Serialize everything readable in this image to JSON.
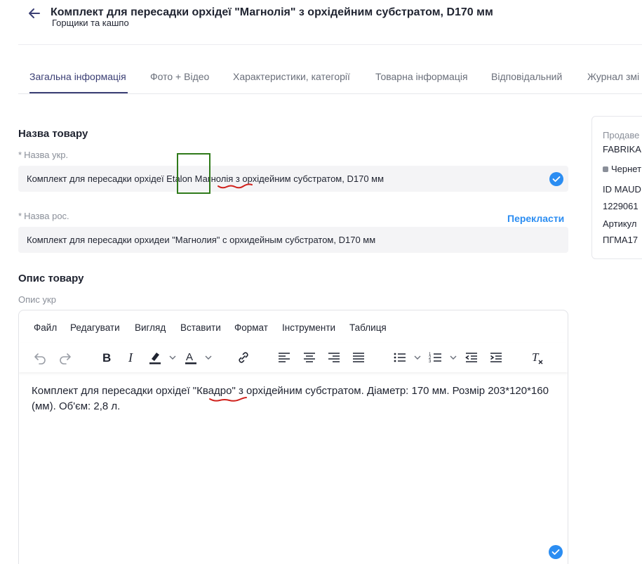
{
  "header": {
    "title": "Комплект для пересадки орхідеї \"Магнолія\" з орхідейним субстратом, D170 мм",
    "subtitle": "Горщики та кашпо"
  },
  "tabs": [
    {
      "label": "Загальна інформація",
      "active": true
    },
    {
      "label": "Фото + Відео"
    },
    {
      "label": "Характеристики, категорії"
    },
    {
      "label": "Товарна інформація"
    },
    {
      "label": "Відповідальний"
    },
    {
      "label": "Журнал змі"
    }
  ],
  "product_name": {
    "section_title": "Назва товару",
    "ukr_label": "Назва укр.",
    "ukr_value_before": "Комплект для пересадки орхідеї ",
    "ukr_value_highlight": "Etalon",
    "ukr_value_after": " Магнолія з орхідейним субстратом, D170 мм",
    "rus_label": "Назва рос.",
    "rus_value": "Комплект для пересадки орхидеи \"Магнолия\" с орхидейным субстратом, D170 мм",
    "translate_label": "Перекласти"
  },
  "description": {
    "section_title": "Опис товару",
    "label": "Опис укр",
    "menu": [
      "Файл",
      "Редагувати",
      "Вигляд",
      "Вставити",
      "Формат",
      "Інструменти",
      "Таблиця"
    ],
    "text": "Комплект для пересадки орхідеї \"Квадро\" з орхідейним субстратом. Діаметр: 170 мм. Розмір 203*120*160 (мм). Об'єм: 2,8 л."
  },
  "side_panel": {
    "seller_label": "Продаве",
    "seller_value": "FABRIKA",
    "status_label": "Чернет",
    "id_label": "ID MAUD",
    "id_value": "1229061",
    "article_label": "Артикул",
    "article_value": "ПГМА17"
  },
  "colors": {
    "accent": "#2b8df2",
    "tab_active": "#3b3f74",
    "highlight_box": "#2f7a1a",
    "spell_underline": "#d0211c"
  }
}
